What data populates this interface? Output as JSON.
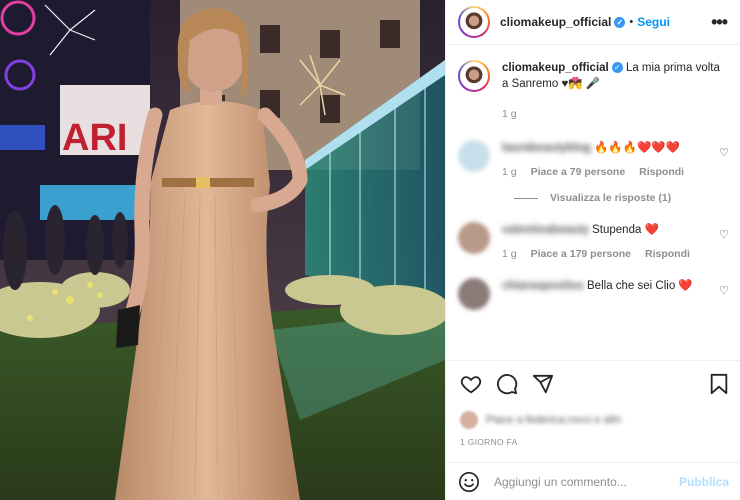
{
  "post": {
    "username": "cliomakeup_official",
    "follow_label": "Segui",
    "more_label": "•••"
  },
  "caption": {
    "username": "cliomakeup_official",
    "text": "La mia prima volta a Sanremo ♥💏 🎤",
    "time": "1 g"
  },
  "comments": [
    {
      "username": "laurabeautyblog",
      "text": "🔥🔥🔥❤️❤️❤️",
      "time": "1 g",
      "likes": "Piace a 79 persone",
      "reply": "Rispondi",
      "view_replies": "Visualizza le risposte (1)"
    },
    {
      "username": "valentinabeauty",
      "text": "Stupenda ❤️",
      "time": "1 g",
      "likes": "Piace a 179 persone",
      "reply": "Rispondi"
    },
    {
      "username": "chiaraspositoo",
      "text": "Bella che sei Clio ❤️"
    }
  ],
  "likes_text": "Piace a federica.rocci e altri",
  "post_time": "1 GIORNO FA",
  "add_comment": {
    "placeholder": "Aggiungi un commento...",
    "publish_label": "Pubblica"
  },
  "colors": {
    "link_blue": "#0095f6",
    "verified_blue": "#3897f0",
    "heart_red": "#ed4956",
    "publish_disabled": "#b2dffc"
  },
  "icons": [
    "verified-badge-icon",
    "more-options-icon",
    "heart-icon",
    "comment-icon",
    "share-icon",
    "bookmark-icon",
    "emoji-icon"
  ]
}
